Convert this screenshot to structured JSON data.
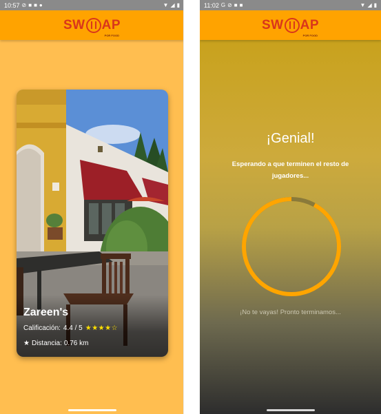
{
  "left_screen": {
    "status_bar": {
      "time": "10:57"
    },
    "app_bar": {
      "logo_text_left": "SW",
      "logo_text_right": "AP",
      "logo_tagline": "POR FOOD"
    },
    "restaurant_card": {
      "name": "Zareen's",
      "rating_label": "Calificación:",
      "rating_value": "4.4 / 5",
      "rating_stars": 4.4,
      "stars_glyphs": "★★★★☆",
      "distance_icon": "★",
      "distance_label": "Distancia:",
      "distance_value": "0.76 km"
    }
  },
  "right_screen": {
    "status_bar": {
      "time": "11:02"
    },
    "app_bar": {
      "logo_text_left": "SW",
      "logo_text_right": "AP",
      "logo_tagline": "POR FOOD"
    },
    "headline": "¡Genial!",
    "waiting_text": "Esperando a que terminen el resto de jugadores...",
    "progress_fraction": 0.92,
    "footer_text": "¡No te vayas! Pronto terminamos..."
  },
  "colors": {
    "app_bar": "#ffa300",
    "left_background": "#ffbe50",
    "logo_red": "#d9361b",
    "progress_orange": "#ffa500",
    "progress_track": "#8a7a3a",
    "star_yellow": "#ffe000"
  },
  "icons": {
    "status_left": [
      "shield-icon",
      "mail-icon",
      "alert-icon"
    ],
    "status_right": [
      "wifi-icon",
      "signal-icon",
      "battery-icon"
    ]
  }
}
